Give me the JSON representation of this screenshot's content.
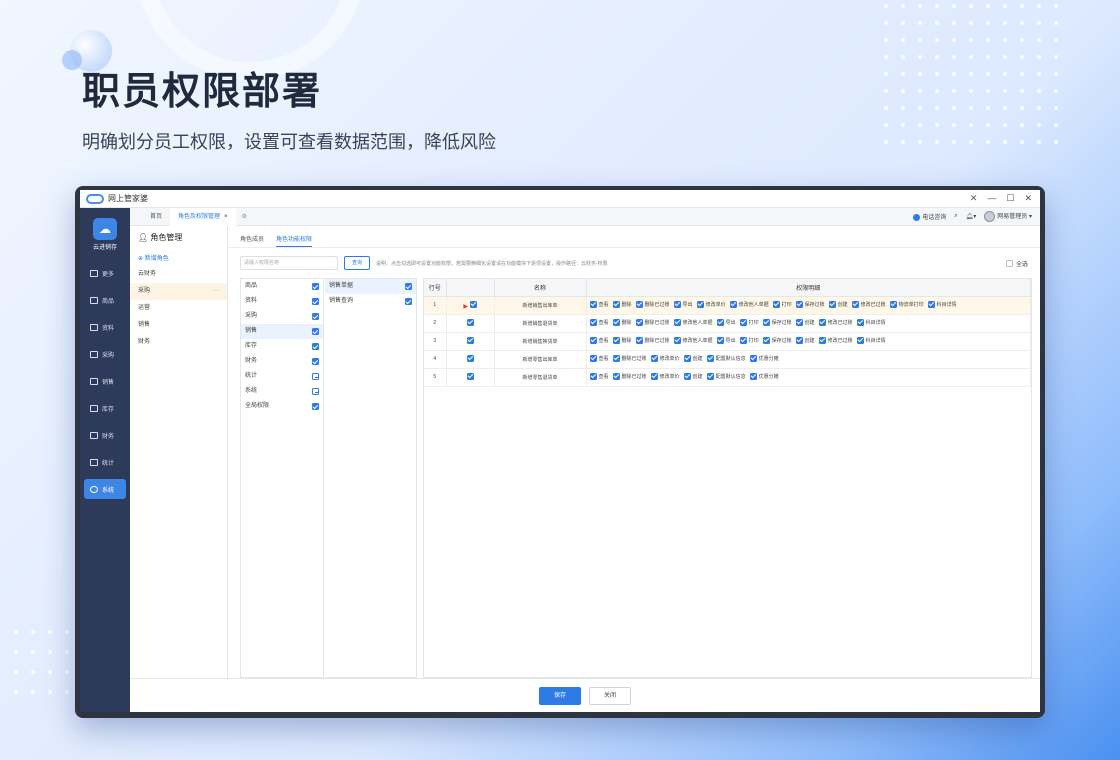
{
  "hero": {
    "title": "职员权限部署",
    "subtitle": "明确划分员工权限，设置可查看数据范围，降低风险"
  },
  "window": {
    "title": "网上管家婆",
    "controls": [
      "✕",
      "—",
      "☐",
      "✕"
    ]
  },
  "sidebar": {
    "brand": "云进销存",
    "items": [
      {
        "label": "更多",
        "icon": "more-icon"
      },
      {
        "label": "商品",
        "icon": "goods-icon"
      },
      {
        "label": "资料",
        "icon": "data-icon"
      },
      {
        "label": "采购",
        "icon": "purchase-icon"
      },
      {
        "label": "销售",
        "icon": "sales-icon"
      },
      {
        "label": "库存",
        "icon": "stock-icon"
      },
      {
        "label": "财务",
        "icon": "finance-icon"
      },
      {
        "label": "统计",
        "icon": "stats-icon"
      },
      {
        "label": "系统",
        "icon": "system-icon",
        "active": true
      }
    ]
  },
  "tabs": [
    {
      "label": "首页"
    },
    {
      "label": "角色及权限管理",
      "active": true
    }
  ],
  "tab_close": "×",
  "header_right": {
    "phone": "电话咨询",
    "user": "网易管理员"
  },
  "rolepane": {
    "title": "角色管理",
    "add": "新增角色",
    "roles": [
      "云财务",
      "采购",
      "运营",
      "销售",
      "财务"
    ],
    "more": "···"
  },
  "subtabs": [
    "角色成员",
    "角色功能权限"
  ],
  "search": {
    "placeholder": "请输入权限名称",
    "button": "查询",
    "hint": "说明：点击勾选即可设置功能权限，若需要精细化设置请在功能模块下逐项设置，操作路径：云财务-权限",
    "select_all": "全选"
  },
  "modules": [
    {
      "label": "商品",
      "state": "checked"
    },
    {
      "label": "资料",
      "state": "checked"
    },
    {
      "label": "采购",
      "state": "checked"
    },
    {
      "label": "销售",
      "state": "checked",
      "selected": true
    },
    {
      "label": "库存",
      "state": "checked"
    },
    {
      "label": "财务",
      "state": "checked"
    },
    {
      "label": "统计",
      "state": "partial"
    },
    {
      "label": "系统",
      "state": "partial"
    },
    {
      "label": "全局权限",
      "state": "checked"
    }
  ],
  "submodules": [
    {
      "label": "销售单据",
      "state": "checked",
      "selected": true
    },
    {
      "label": "销售查询",
      "state": "checked"
    }
  ],
  "grid": {
    "headers": [
      "行号",
      "",
      "名称",
      "权限明细"
    ],
    "rows": [
      {
        "no": "1",
        "name": "新增销售出库单",
        "selected": true,
        "perms": [
          "查看",
          "删除",
          "删除已过账",
          "导出",
          "修改单价",
          "修改他人单据",
          "打印",
          "保存过账",
          "创建",
          "修改已过账",
          "物流单打印",
          "科目详情"
        ]
      },
      {
        "no": "2",
        "name": "新增销售退货单",
        "perms": [
          "查看",
          "删除",
          "删除已过账",
          "修改他人单据",
          "导出",
          "打印",
          "保存过账",
          "创建",
          "修改已过账",
          "科目详情"
        ]
      },
      {
        "no": "3",
        "name": "新增销售换货单",
        "perms": [
          "查看",
          "删除",
          "删除已过账",
          "修改他人单据",
          "导出",
          "打印",
          "保存过账",
          "创建",
          "修改已过账",
          "科目详情"
        ]
      },
      {
        "no": "4",
        "name": "新增零售出库单",
        "perms": [
          "查看",
          "删除已过账",
          "修改单价",
          "创建",
          "配置默认信息",
          "优惠分摊"
        ]
      },
      {
        "no": "5",
        "name": "新增零售退货单",
        "perms": [
          "查看",
          "删除已过账",
          "修改单价",
          "创建",
          "配置默认信息",
          "优惠分摊"
        ]
      }
    ]
  },
  "footer": {
    "save": "保存",
    "close": "关闭"
  },
  "colors": {
    "accent": "#2d7be5",
    "sidebar": "#2d3a5a",
    "selected_row": "#fff8e8"
  }
}
